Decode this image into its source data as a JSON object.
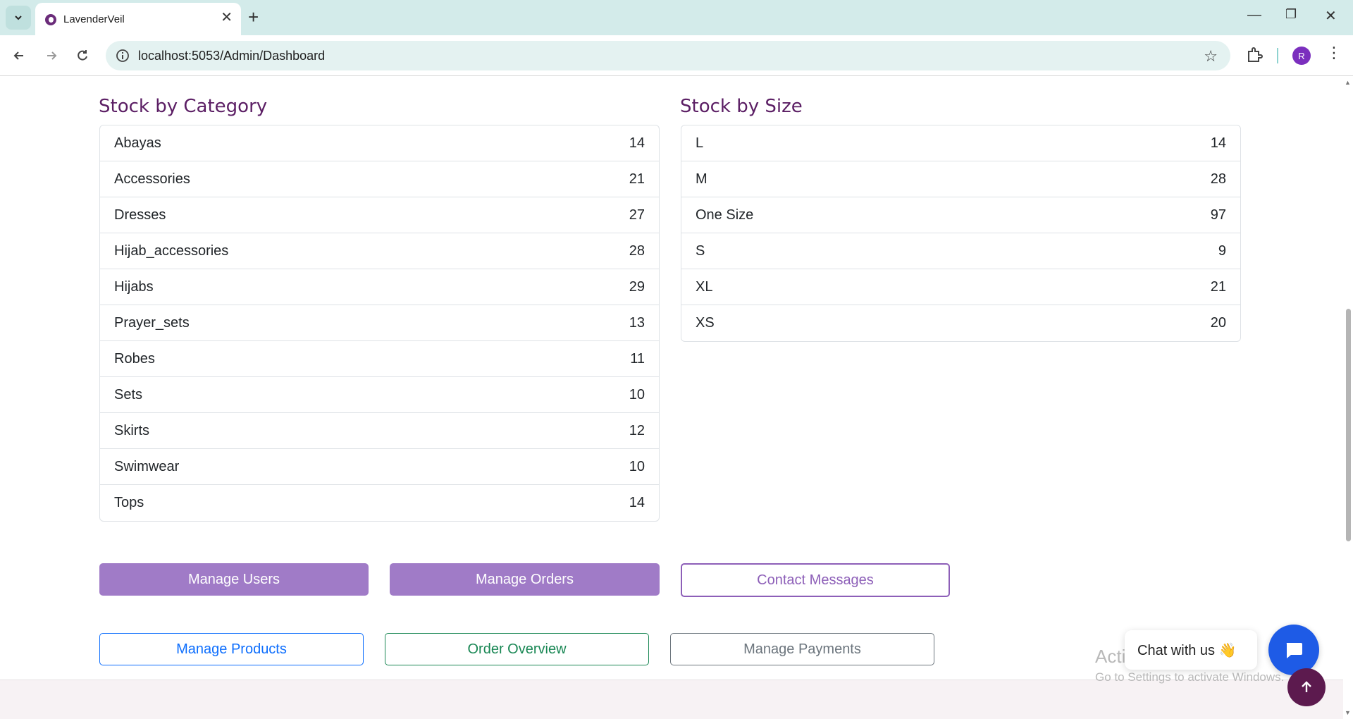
{
  "browser": {
    "tab_title": "LavenderVeil",
    "url": "localhost:5053/Admin/Dashboard",
    "profile_initial": "R"
  },
  "stock_by_category": {
    "title": "Stock by Category",
    "items": [
      {
        "name": "Abayas",
        "count": "14"
      },
      {
        "name": "Accessories",
        "count": "21"
      },
      {
        "name": "Dresses",
        "count": "27"
      },
      {
        "name": "Hijab_accessories",
        "count": "28"
      },
      {
        "name": "Hijabs",
        "count": "29"
      },
      {
        "name": "Prayer_sets",
        "count": "13"
      },
      {
        "name": "Robes",
        "count": "11"
      },
      {
        "name": "Sets",
        "count": "10"
      },
      {
        "name": "Skirts",
        "count": "12"
      },
      {
        "name": "Swimwear",
        "count": "10"
      },
      {
        "name": "Tops",
        "count": "14"
      }
    ]
  },
  "stock_by_size": {
    "title": "Stock by Size",
    "items": [
      {
        "name": "L",
        "count": "14"
      },
      {
        "name": "M",
        "count": "28"
      },
      {
        "name": "One Size",
        "count": "97"
      },
      {
        "name": "S",
        "count": "9"
      },
      {
        "name": "XL",
        "count": "21"
      },
      {
        "name": "XS",
        "count": "20"
      }
    ]
  },
  "actions": {
    "manage_users": "Manage Users",
    "manage_orders": "Manage Orders",
    "contact_messages": "Contact Messages",
    "manage_products": "Manage Products",
    "order_overview": "Order Overview",
    "manage_payments": "Manage Payments"
  },
  "chat": {
    "bubble_text": "Chat with us 👋"
  },
  "watermark": {
    "title": "Activate Windows",
    "subtitle": "Go to Settings to activate Windows."
  },
  "colors": {
    "heading": "#5b1e64",
    "button_purple": "#a07bc7",
    "chat_blue": "#1e5be6",
    "back_to_top": "#5c1a4e"
  }
}
